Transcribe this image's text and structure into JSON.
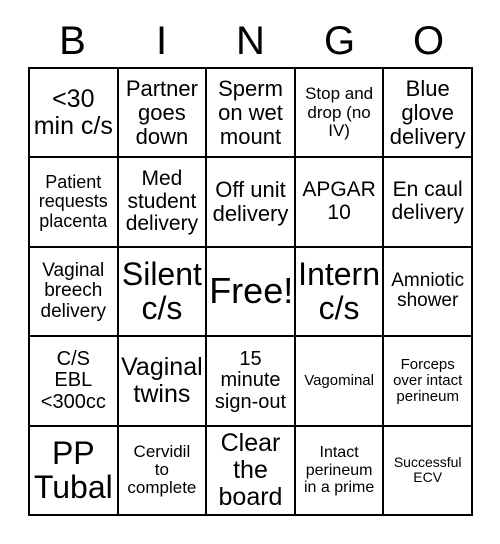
{
  "card": {
    "title": "BINGO",
    "background_color": "#ffffff",
    "text_color": "#000000",
    "border_color": "#000000",
    "columns": 5,
    "rows": 5
  },
  "header": {
    "letters": [
      "B",
      "I",
      "N",
      "G",
      "O"
    ]
  },
  "grid": {
    "rows": [
      [
        {
          "text": "<30\nmin c/s",
          "size": "fs-25"
        },
        {
          "text": "Partner\ngoes\ndown",
          "size": "fs-22"
        },
        {
          "text": "Sperm\non wet\nmount",
          "size": "fs-22"
        },
        {
          "text": "Stop and\ndrop (no\nIV)",
          "size": "fs-17"
        },
        {
          "text": "Blue\nglove\ndelivery",
          "size": "fs-22"
        }
      ],
      [
        {
          "text": "Patient\nrequests\nplacenta",
          "size": "fs-18"
        },
        {
          "text": "Med\nstudent\ndelivery",
          "size": "fs-21"
        },
        {
          "text": "Off unit\ndelivery",
          "size": "fs-22"
        },
        {
          "text": "APGAR\n10",
          "size": "fs-21"
        },
        {
          "text": "En caul\ndelivery",
          "size": "fs-21"
        }
      ],
      [
        {
          "text": "Vaginal\nbreech\ndelivery",
          "size": "fs-19"
        },
        {
          "text": "Silent\nc/s",
          "size": "fs-32"
        },
        {
          "text": "Free!",
          "size": "fs-36"
        },
        {
          "text": "Intern\nc/s",
          "size": "fs-32"
        },
        {
          "text": "Amniotic\nshower",
          "size": "fs-19"
        }
      ],
      [
        {
          "text": "C/S\nEBL\n<300cc",
          "size": "fs-20"
        },
        {
          "text": "Vaginal\ntwins",
          "size": "fs-25"
        },
        {
          "text": "15\nminute\nsign-out",
          "size": "fs-20"
        },
        {
          "text": "Vagominal",
          "size": "fs-15"
        },
        {
          "text": "Forceps\nover intact\nperineum",
          "size": "fs-15"
        }
      ],
      [
        {
          "text": "PP\nTubal",
          "size": "fs-32"
        },
        {
          "text": "Cervidil\nto\ncomplete",
          "size": "fs-17"
        },
        {
          "text": "Clear\nthe\nboard",
          "size": "fs-25"
        },
        {
          "text": "Intact\nperineum\nin a prime",
          "size": "fs-16"
        },
        {
          "text": "Successful\nECV",
          "size": "fs-14"
        }
      ]
    ]
  }
}
